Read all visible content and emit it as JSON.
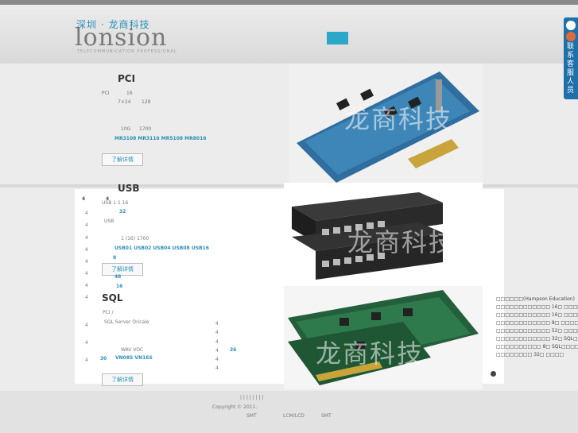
{
  "brand": {
    "cn": "深圳 · 龙商科技",
    "en": "lonsion",
    "tagline": "TELECOMMUNICATION PROFESSIONAL"
  },
  "sidebar_tab": {
    "label": "联系客服人员"
  },
  "sections": {
    "pci": {
      "title": "PCI",
      "line1a": "PCI",
      "line1b": "16",
      "line2a": "7×24",
      "line2b": "128",
      "line3a": "10G",
      "line3b": "1700",
      "models": "MR3108  MR3116  MR5108  MR8016",
      "button": "了解详情"
    },
    "usb": {
      "title": "USB",
      "line1": "USB     1  1 16",
      "line2": "32",
      "line3": "USB",
      "line4": "1 (16)  1700",
      "models": "USB01  USB02  USB04  USB08  USB16",
      "button": "了解详情"
    },
    "sql": {
      "title": "SQL",
      "line1": "PCI   /",
      "line2": "SQL Server Oricale",
      "line3": "WAV  VOC",
      "models": "VN08S  VN16S",
      "num30": "30",
      "num26": "26",
      "button": "了解详情"
    }
  },
  "left_digits": [
    "4",
    "4",
    "4",
    "4",
    "4",
    "4",
    "4",
    "4",
    "4",
    "4",
    "4",
    "4",
    "4"
  ],
  "mid_digits": [
    "4",
    "4",
    "4",
    "4",
    "4",
    "4"
  ],
  "blue_nums": [
    "32",
    "8",
    "48",
    "16"
  ],
  "news": [
    "□□□□□□(Hampson Education)",
    "□□□□□□□□□□□□ 16□ □□□□",
    "□□□□□□□□□□□□ 16□ □□□□",
    "□□□□□□□□□□□□ 8□ □□□□",
    "□□□□□□□□□□□□ 52□ □□□□",
    "□□□□□□□□□□□□ 32□ SQL□□□□",
    "□□□□□□□□□□ 8□ SQL□□□□",
    "□□□□□□□□ 32□ □□□□"
  ],
  "watermark": "龙商科技",
  "footer": {
    "dividers": "|    |    |    |    |    |    |    |",
    "copyright": "Copyright © 2011.",
    "smt1": "SMT",
    "lcm": "LCM/LCD",
    "smt2": "SMT"
  }
}
